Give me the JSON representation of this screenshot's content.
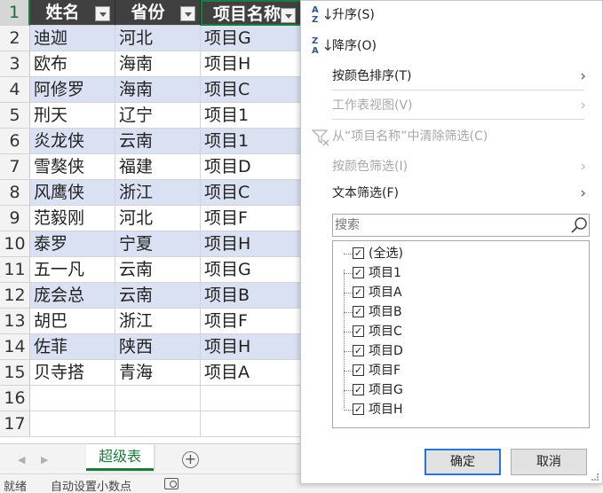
{
  "sheet": {
    "header": {
      "row_number": "1",
      "col1": "姓名",
      "col2": "省份",
      "col3": "项目名称"
    },
    "rows": [
      {
        "num": "2",
        "name": "迪迦",
        "province": "河北",
        "project": "项目G"
      },
      {
        "num": "3",
        "name": "欧布",
        "province": "海南",
        "project": "项目H"
      },
      {
        "num": "4",
        "name": "阿修罗",
        "province": "海南",
        "project": "项目C"
      },
      {
        "num": "5",
        "name": "刑天",
        "province": "辽宁",
        "project": "项目1"
      },
      {
        "num": "6",
        "name": "炎龙侠",
        "province": "云南",
        "project": "项目1"
      },
      {
        "num": "7",
        "name": "雪獒侠",
        "province": "福建",
        "project": "项目D"
      },
      {
        "num": "8",
        "name": "风鹰侠",
        "province": "浙江",
        "project": "项目C"
      },
      {
        "num": "9",
        "name": "范毅刚",
        "province": "河北",
        "project": "项目F"
      },
      {
        "num": "10",
        "name": "泰罗",
        "province": "宁夏",
        "project": "项目H"
      },
      {
        "num": "11",
        "name": "五一凡",
        "province": "云南",
        "project": "项目G"
      },
      {
        "num": "12",
        "name": "庞会总",
        "province": "云南",
        "project": "项目B"
      },
      {
        "num": "13",
        "name": "胡巴",
        "province": "浙江",
        "project": "项目F"
      },
      {
        "num": "14",
        "name": "佐菲",
        "province": "陕西",
        "project": "项目H"
      },
      {
        "num": "15",
        "name": "贝寺搭",
        "province": "青海",
        "project": "项目A"
      },
      {
        "num": "16",
        "name": "",
        "province": "",
        "project": ""
      },
      {
        "num": "17",
        "name": "",
        "province": "",
        "project": ""
      }
    ],
    "tab_label": "超级表"
  },
  "status": {
    "ready": "就绪",
    "auto_decimal": "自动设置小数点"
  },
  "filter_menu": {
    "sort_asc": "升序(S)",
    "sort_desc": "降序(O)",
    "sort_by_color": "按颜色排序(T)",
    "sheet_view": "工作表视图(V)",
    "clear_filter": "从“项目名称”中清除筛选(C)",
    "filter_by_color": "按颜色筛选(I)",
    "text_filter": "文本筛选(F)",
    "search_placeholder": "搜索",
    "items": [
      "(全选)",
      "项目1",
      "项目A",
      "项目B",
      "项目C",
      "项目D",
      "项目F",
      "项目G",
      "项目H"
    ],
    "ok": "确定",
    "cancel": "取消"
  },
  "colors": {
    "header_bg": "#404040",
    "band": "#d9e1f2",
    "accent_green": "#1d7a3e",
    "ok_border": "#2b73d4"
  }
}
